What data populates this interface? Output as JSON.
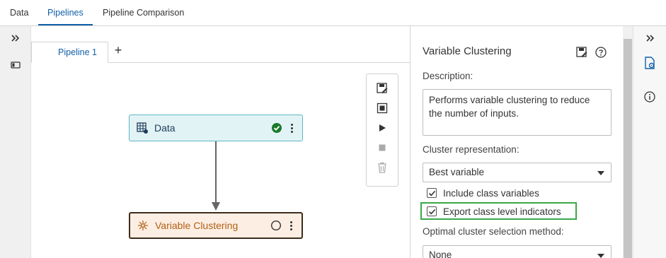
{
  "top_tabs": [
    "Data",
    "Pipelines",
    "Pipeline Comparison"
  ],
  "pipeline": {
    "tab_label": "Pipeline 1",
    "add_label": "+",
    "nodes": {
      "data_label": "Data",
      "vc_label": "Variable Clustering"
    }
  },
  "properties": {
    "title": "Variable Clustering",
    "description_label": "Description:",
    "description_text": "Performs variable clustering to reduce the number of inputs.",
    "cluster_rep_label": "Cluster representation:",
    "cluster_rep_value": "Best variable",
    "include_class_label": "Include class variables",
    "export_class_label": "Export class level indicators",
    "optimal_label": "Optimal cluster selection method:",
    "optimal_value": "None"
  },
  "icons": {
    "collapse": "double-chevron-right-icon",
    "status_ok": "check-circle-icon",
    "status_pending": "empty-circle-icon",
    "help": "question-circle-icon",
    "info": "info-circle-icon"
  },
  "colors": {
    "accent": "#1160a8",
    "success": "#1b7a2b",
    "highlight": "#3aa84a"
  }
}
